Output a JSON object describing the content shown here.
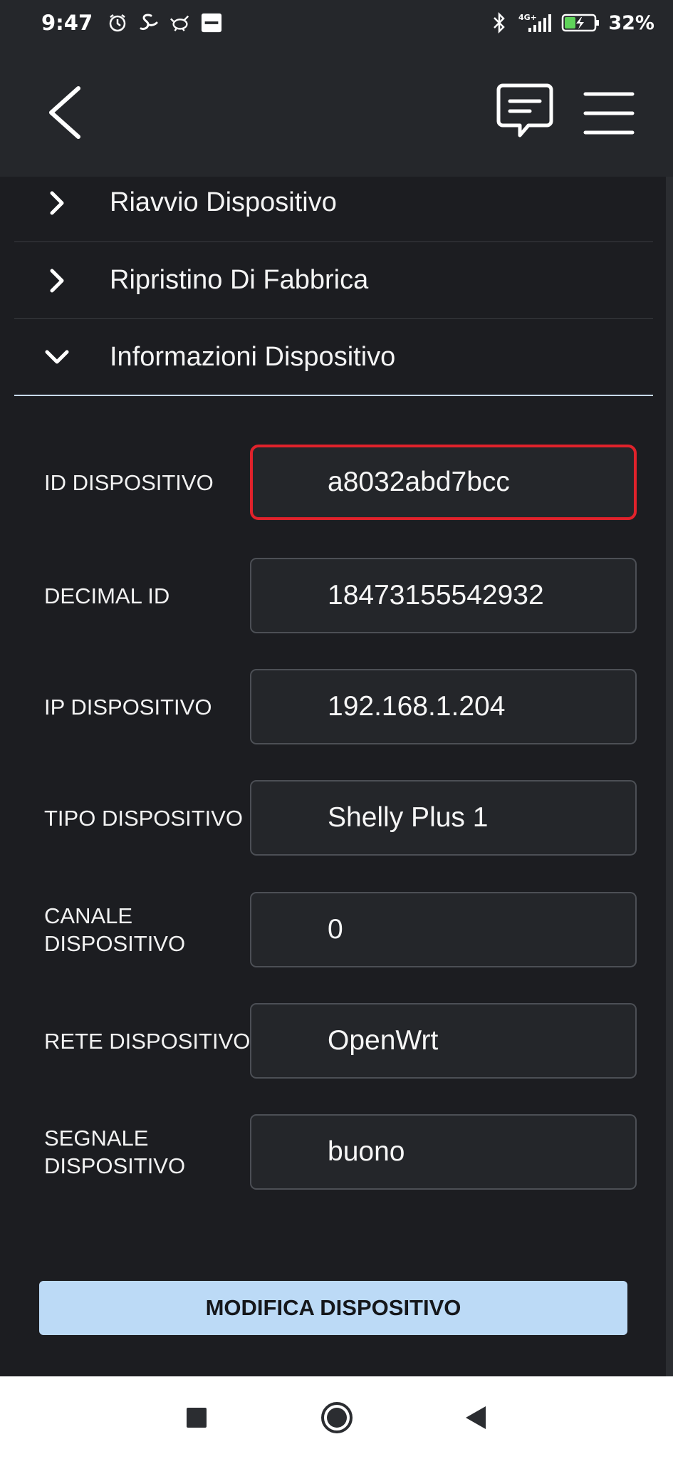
{
  "status_bar": {
    "time": "9:47",
    "network": "4G+",
    "battery_percent": "32%",
    "left_icons": [
      "alarm-icon",
      "swirl-icon",
      "bird-icon",
      "ifttt-icon"
    ],
    "right_icons": [
      "bluetooth-icon",
      "signal-icon",
      "battery-charging-icon"
    ]
  },
  "app_bar": {
    "icons": [
      "back-chevron-icon",
      "chat-icon",
      "hamburger-menu-icon"
    ]
  },
  "accordion": [
    {
      "label": "Riavvio Dispositivo",
      "expanded": false
    },
    {
      "label": "Ripristino Di Fabbrica",
      "expanded": false
    },
    {
      "label": "Informazioni Dispositivo",
      "expanded": true
    }
  ],
  "device_info": [
    {
      "label": "ID DISPOSITIVO",
      "value": "a8032abd7bcc",
      "highlighted": true
    },
    {
      "label": "DECIMAL ID",
      "value": "18473155542932"
    },
    {
      "label": "IP DISPOSITIVO",
      "value": "192.168.1.204"
    },
    {
      "label": "TIPO DISPOSITIVO",
      "value": "Shelly Plus 1"
    },
    {
      "label": "CANALE DISPOSITIVO",
      "value": "0"
    },
    {
      "label": "RETE DISPOSITIVO",
      "value": "OpenWrt"
    },
    {
      "label": "SEGNALE DISPOSITIVO",
      "value": "buono"
    }
  ],
  "edit_button_label": "MODIFICA DISPOSITIVO",
  "colors": {
    "background": "#1c1d21",
    "app_bar": "#25272b",
    "field_bg": "#24262a",
    "field_border": "#4c4f55",
    "highlight_border": "#e0222b",
    "button_bg": "#bcdaf6",
    "divider_active": "#c7daf2"
  },
  "nav_bar": {
    "icons": [
      "recents-square-icon",
      "home-circle-icon",
      "back-triangle-icon"
    ]
  }
}
